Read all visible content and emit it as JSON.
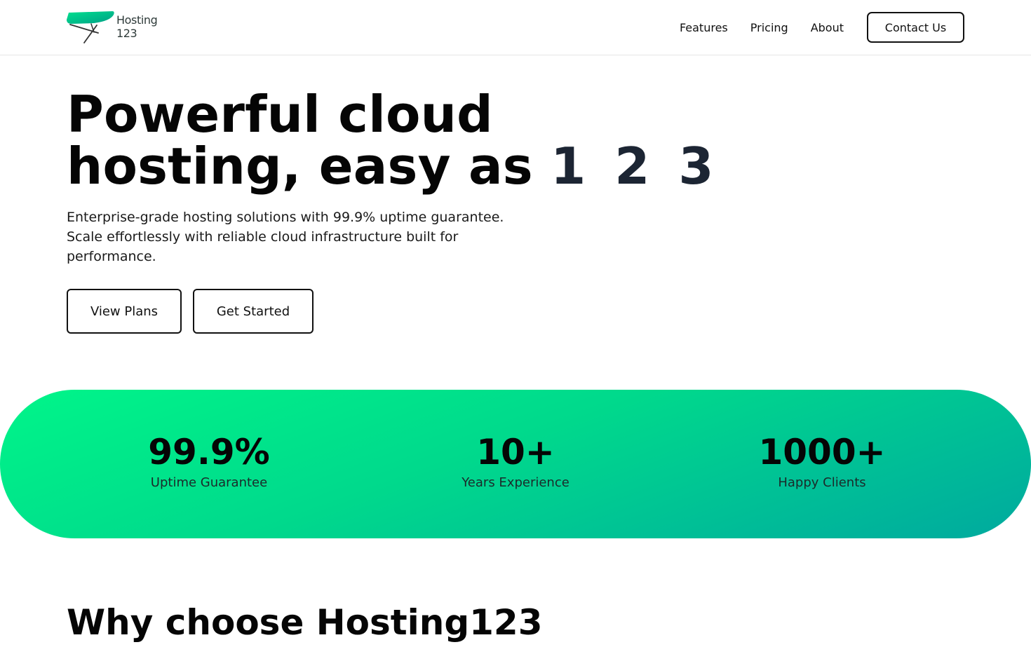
{
  "header": {
    "logo": {
      "line1": "Hosting",
      "line2": "123",
      "icon": "ironing-board-icon",
      "colors": {
        "top": "#00e08e",
        "bottom": "#009e86",
        "legs": "#333333"
      }
    },
    "nav": [
      {
        "label": "Features"
      },
      {
        "label": "Pricing"
      },
      {
        "label": "About"
      }
    ],
    "contact_label": "Contact Us"
  },
  "hero": {
    "title_line1": "Powerful cloud",
    "title_line2_prefix": "hosting, easy as ",
    "title_line2_accent": "1 2 3",
    "subtitle": "Enterprise-grade hosting solutions with 99.9% uptime guarantee. Scale effortlessly with reliable cloud infrastructure built for performance.",
    "buttons": {
      "plans": "View Plans",
      "start": "Get Started"
    }
  },
  "stats": [
    {
      "value": "99.9%",
      "label": "Uptime Guarantee"
    },
    {
      "value": "10+",
      "label": "Years Experience"
    },
    {
      "value": "1000+",
      "label": "Happy Clients"
    }
  ],
  "why": {
    "title": "Why choose Hosting123"
  },
  "colors": {
    "accent_start": "#00f589",
    "accent_end": "#00a99f",
    "text": "#050505",
    "accent_digits": "#1c2533"
  }
}
